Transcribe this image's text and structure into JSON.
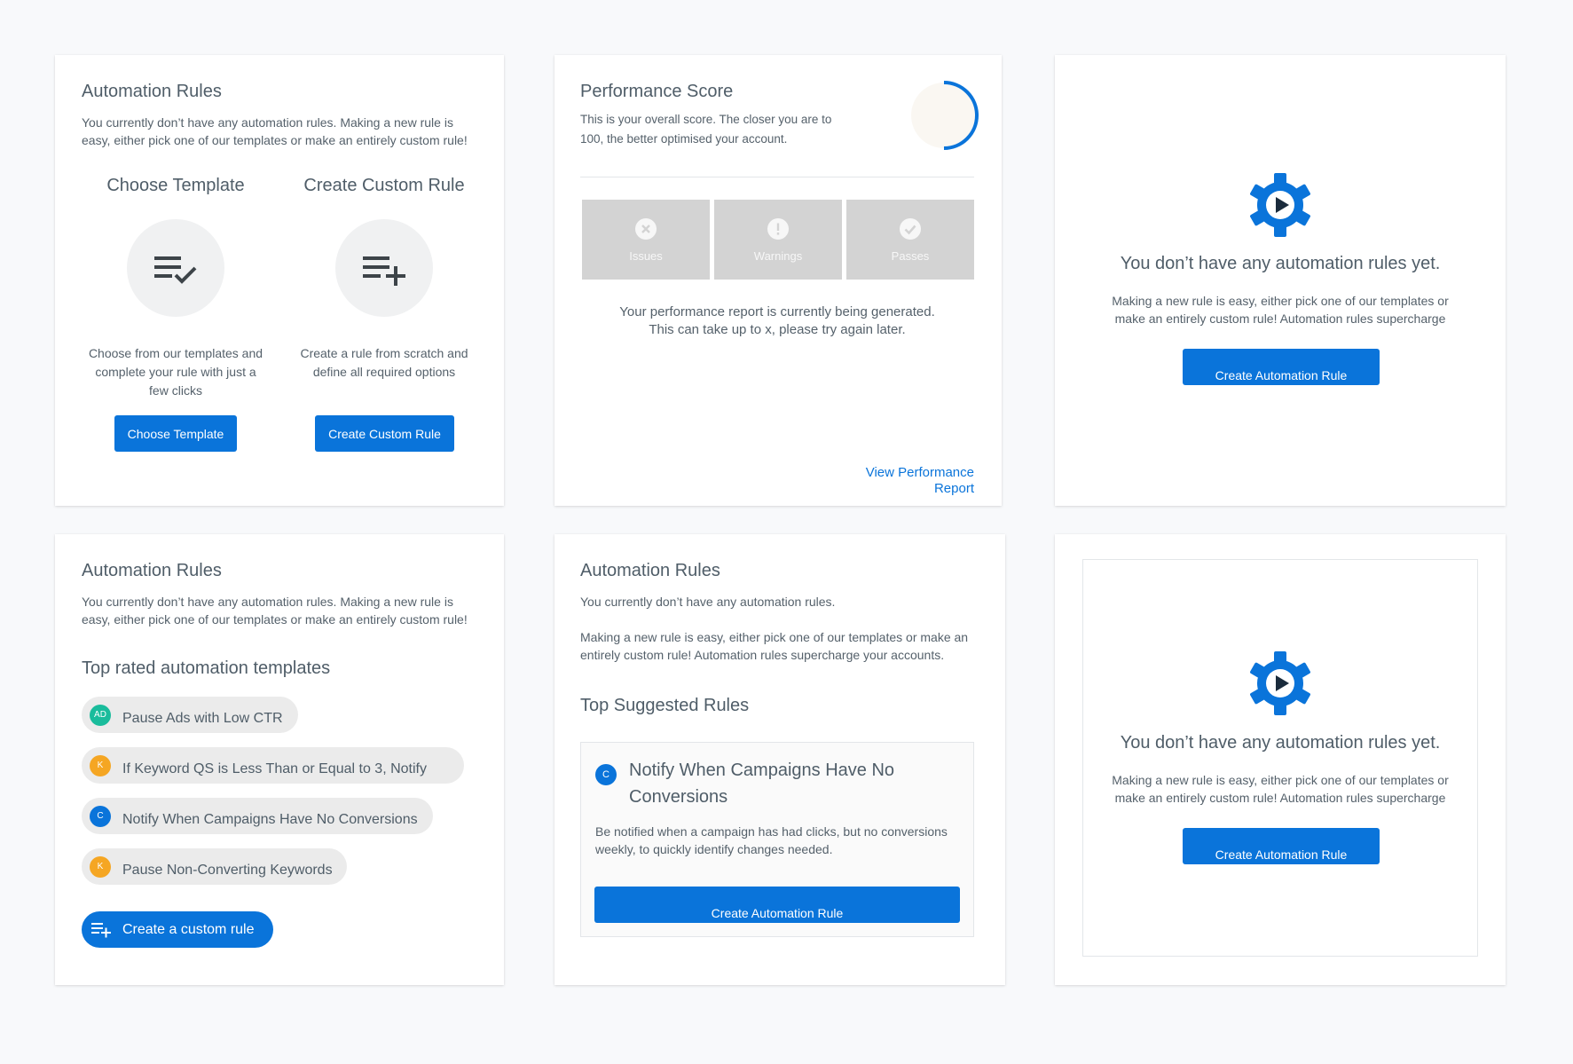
{
  "colors": {
    "accent": "#0a74da",
    "teal": "#1abc9c",
    "amber": "#f5a623",
    "metric_bg": "#d3d3d3",
    "gauge_bg": "#faf7f2"
  },
  "card1": {
    "title": "Automation Rules",
    "description": "You currently don’t have any automation rules. Making a new rule is easy, either pick one of our templates or make an entirely custom rule!",
    "choose": {
      "title": "Choose Template",
      "icon": "list-check-icon",
      "description": "Choose from our templates and complete your rule with just a few clicks",
      "button": "Choose Template"
    },
    "custom": {
      "title": "Create Custom Rule",
      "icon": "list-add-icon",
      "description": "Create a rule from scratch and define all required options",
      "button": "Create Custom Rule"
    }
  },
  "card2": {
    "title": "Performance Score",
    "description": "This is your overall score. The closer you are to 100, the better optimised your account.",
    "metrics": [
      {
        "label": "Issues",
        "icon": "x-circle-icon"
      },
      {
        "label": "Warnings",
        "icon": "exclamation-circle-icon"
      },
      {
        "label": "Passes",
        "icon": "check-circle-icon"
      }
    ],
    "note_line1": "Your performance report is currently being generated.",
    "note_line2": "This can take up to x, please try again later.",
    "link_line1": "View Performance",
    "link_line2": "Report"
  },
  "card3": {
    "icon": "gear-play-icon",
    "title": "You don’t have any automation rules yet.",
    "description_line1": "Making a new rule is easy, either pick one of our templates or",
    "description_line2": "make an entirely custom rule! Automation rules supercharge",
    "button": "Create Automation Rule"
  },
  "card4": {
    "title": "Automation Rules",
    "description": "You currently don’t have any automation rules. Making a new rule is easy, either pick one of our templates or make an entirely custom rule!",
    "templates_heading": "Top rated automation templates",
    "templates": [
      {
        "badge": "AD",
        "badge_color": "#1abc9c",
        "label": "Pause Ads with Low CTR"
      },
      {
        "badge": "K",
        "badge_color": "#f5a623",
        "label": "If Keyword QS is Less Than or Equal to 3, Notify"
      },
      {
        "badge": "C",
        "badge_color": "#0a74da",
        "label": "Notify When Campaigns Have No Conversions"
      },
      {
        "badge": "K",
        "badge_color": "#f5a623",
        "label": "Pause Non-Converting Keywords"
      }
    ],
    "custom_button": "Create a custom rule"
  },
  "card5": {
    "title": "Automation Rules",
    "description1": "You currently don’t have any automation rules.",
    "description2": "Making a new rule is easy, either pick one of our templates or make an entirely custom rule! Automation rules supercharge your accounts.",
    "suggested_heading": "Top Suggested Rules",
    "rule": {
      "badge": "C",
      "title": "Notify When Campaigns Have No Conversions",
      "description": "Be notified when a campaign has had clicks, but no conversions weekly, to quickly identify changes needed.",
      "button": "Create Automation Rule"
    }
  },
  "card6": {
    "icon": "gear-play-icon",
    "title": "You don’t have any automation rules yet.",
    "description_line1": "Making a new rule is easy, either pick one of our templates or",
    "description_line2": "make an entirely custom rule! Automation rules supercharge",
    "button": "Create Automation Rule"
  }
}
